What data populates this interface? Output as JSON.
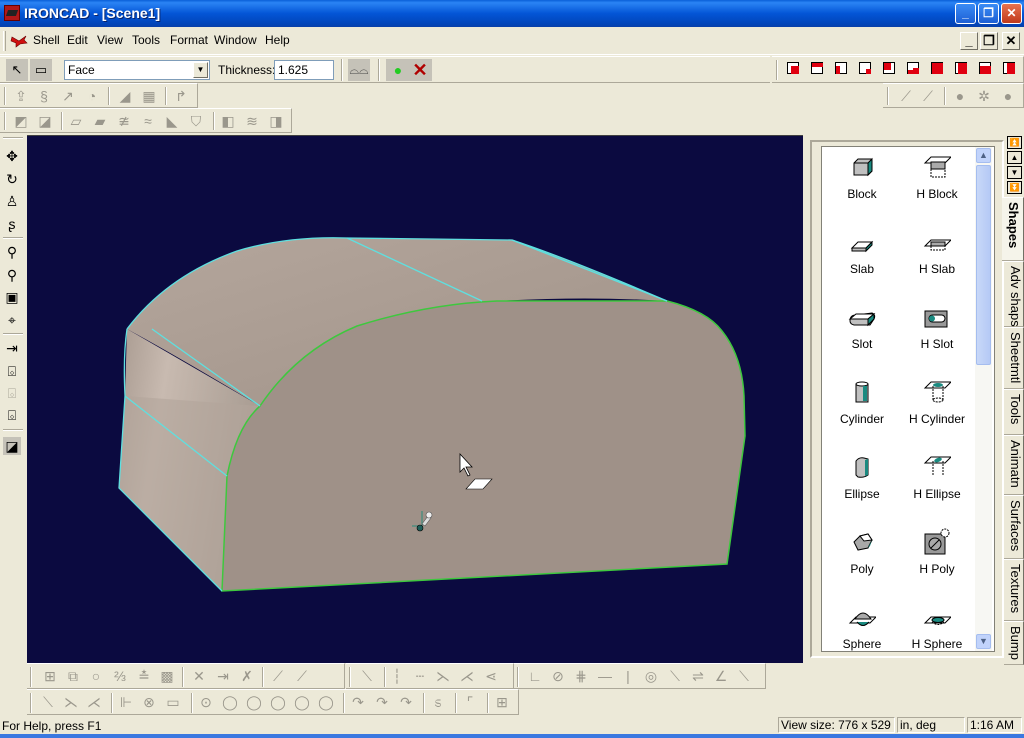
{
  "window": {
    "title": "IRONCAD - [Scene1]",
    "buttons": [
      "minimize",
      "restore",
      "close"
    ]
  },
  "menubar": {
    "items": [
      "Shell",
      "Edit",
      "View",
      "Tools",
      "Format",
      "Window",
      "Help"
    ],
    "mdi_buttons": [
      "minimize",
      "restore",
      "close"
    ]
  },
  "shell_toolbar": {
    "select_mode": "Face",
    "thickness_label": "Thickness:",
    "thickness_value": "1.625",
    "icons": [
      "select-arrow-icon",
      "select-box-icon",
      "glasses-icon",
      "accept-icon",
      "cancel-icon"
    ]
  },
  "view_cube_toolbar": {
    "icons": [
      "view-cube-1",
      "view-cube-2",
      "view-cube-3",
      "view-cube-4",
      "view-cube-5",
      "view-cube-6",
      "view-cube-7",
      "view-cube-8",
      "view-cube-9",
      "view-cube-10"
    ]
  },
  "catalog": {
    "items": [
      {
        "label": "Block"
      },
      {
        "label": "H Block"
      },
      {
        "label": "Slab"
      },
      {
        "label": "H Slab"
      },
      {
        "label": "Slot"
      },
      {
        "label": "H Slot"
      },
      {
        "label": "Cylinder"
      },
      {
        "label": "H Cylinder"
      },
      {
        "label": "Ellipse"
      },
      {
        "label": "H Ellipse"
      },
      {
        "label": "Poly"
      },
      {
        "label": "H Poly"
      },
      {
        "label": "Sphere"
      },
      {
        "label": "H Sphere"
      }
    ],
    "tabs": [
      "Shapes",
      "Adv shaps",
      "Sheetmtl",
      "Tools",
      "Animatn",
      "Surfaces",
      "Textures",
      "Bump"
    ],
    "active_tab": "Shapes"
  },
  "colors": {
    "viewport_bg": "#0b0a40",
    "part_face": "#a09288",
    "selected_edge": "#3ec83e",
    "edge": "#5ee0e0",
    "cube_accent": "#e00010"
  },
  "statusbar": {
    "help": "For Help, press F1",
    "view_size": "View size:  776 x  529",
    "units": "in, deg",
    "time": "1:16 AM"
  }
}
